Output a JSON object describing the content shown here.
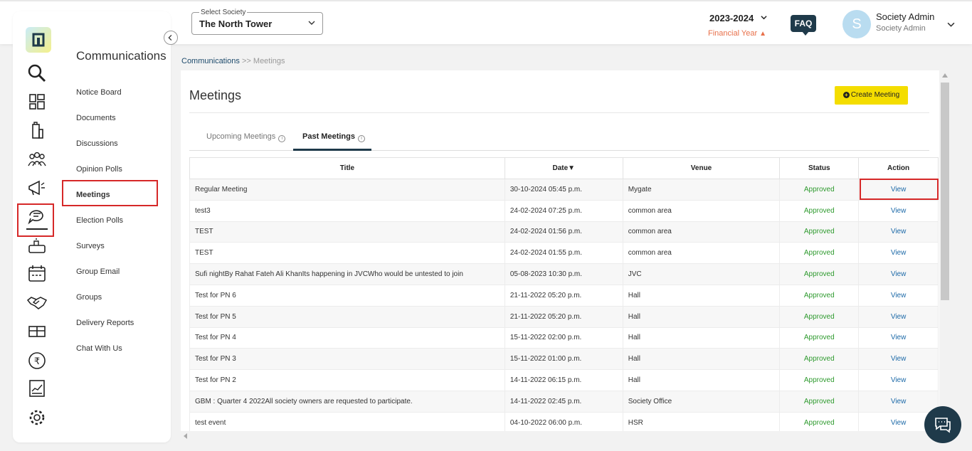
{
  "header": {
    "society_label": "Select Society",
    "society_value": "The North Tower",
    "year": "2023-2024",
    "financial_year": "Financial Year",
    "faq": "FAQ",
    "avatar_letter": "S",
    "user_name": "Society Admin",
    "user_role": "Society Admin"
  },
  "sidebar": {
    "icons": [
      "search-icon",
      "dashboard-icon",
      "building-icon",
      "people-icon",
      "megaphone-icon",
      "chat-icon",
      "parking-icon",
      "calendar-icon",
      "handshake-icon",
      "gift-icon",
      "rupee-icon",
      "chart-icon",
      "settings-icon"
    ]
  },
  "subnav": {
    "title": "Communications",
    "items": [
      "Notice Board",
      "Documents",
      "Discussions",
      "Opinion Polls",
      "Meetings",
      "Election Polls",
      "Surveys",
      "Group Email",
      "Groups",
      "Delivery Reports",
      "Chat With Us"
    ]
  },
  "breadcrumb": {
    "parent": "Communications",
    "sep": ">>",
    "current": "Meetings"
  },
  "main": {
    "title": "Meetings",
    "create_button": "Create Meeting",
    "tabs": [
      "Upcoming Meetings",
      "Past Meetings"
    ],
    "columns": [
      "Title",
      "Date",
      "Venue",
      "Status",
      "Action"
    ],
    "sort_indicator": "▼",
    "rows": [
      {
        "title": "Regular Meeting",
        "date": "30-10-2024 05:45 p.m.",
        "venue": "Mygate",
        "status": "Approved",
        "action": "View"
      },
      {
        "title": "test3",
        "date": "24-02-2024 07:25 p.m.",
        "venue": "common area",
        "status": "Approved",
        "action": "View"
      },
      {
        "title": "TEST",
        "date": "24-02-2024 01:56 p.m.",
        "venue": "common area",
        "status": "Approved",
        "action": "View"
      },
      {
        "title": "TEST",
        "date": "24-02-2024 01:55 p.m.",
        "venue": "common area",
        "status": "Approved",
        "action": "View"
      },
      {
        "title": "Sufi nightBy Rahat Fateh Ali KhanIts happening in JVCWho would be untested to join",
        "date": "05-08-2023 10:30 p.m.",
        "venue": "JVC",
        "status": "Approved",
        "action": "View"
      },
      {
        "title": "Test for PN 6",
        "date": "21-11-2022 05:20 p.m.",
        "venue": "Hall",
        "status": "Approved",
        "action": "View"
      },
      {
        "title": "Test for PN 5",
        "date": "21-11-2022 05:20 p.m.",
        "venue": "Hall",
        "status": "Approved",
        "action": "View"
      },
      {
        "title": "Test for PN 4",
        "date": "15-11-2022 02:00 p.m.",
        "venue": "Hall",
        "status": "Approved",
        "action": "View"
      },
      {
        "title": "Test for PN 3",
        "date": "15-11-2022 01:00 p.m.",
        "venue": "Hall",
        "status": "Approved",
        "action": "View"
      },
      {
        "title": "Test for PN 2",
        "date": "14-11-2022 06:15 p.m.",
        "venue": "Hall",
        "status": "Approved",
        "action": "View"
      },
      {
        "title": "GBM : Quarter 4 2022All society owners are requested to participate.",
        "date": "14-11-2022 02:45 p.m.",
        "venue": "Society Office",
        "status": "Approved",
        "action": "View"
      },
      {
        "title": "test event",
        "date": "04-10-2022 06:00 p.m.",
        "venue": "HSR",
        "status": "Approved",
        "action": "View"
      }
    ]
  },
  "colors": {
    "accent": "#f4dd00",
    "navy": "#1f3a4a",
    "approved": "#2e9a2e",
    "link": "#1d6aa8",
    "highlight": "#d62828"
  }
}
